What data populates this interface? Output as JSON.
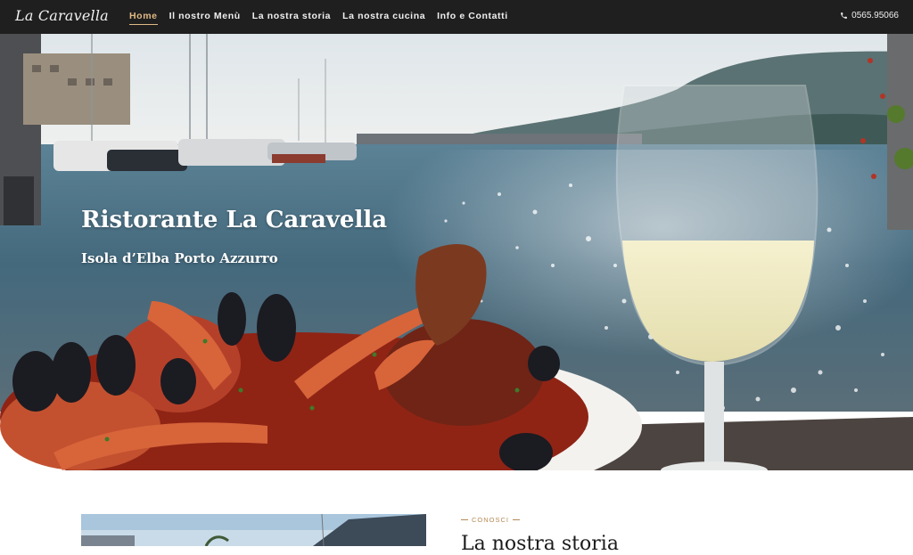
{
  "nav": {
    "logo": "La Caravella",
    "items": [
      {
        "label": "Home",
        "active": true
      },
      {
        "label": "Il nostro Menù",
        "active": false
      },
      {
        "label": "La nostra storia",
        "active": false
      },
      {
        "label": "La nostra cucina",
        "active": false
      },
      {
        "label": "Info e Contatti",
        "active": false
      }
    ],
    "phone": "0565.95066",
    "phone_icon": "phone-icon",
    "accent_color": "#e0b985",
    "bar_color": "#1f1f1f"
  },
  "hero": {
    "title": "Ristorante La Caravella",
    "subtitle": "Isola d’Elba Porto Azzurro"
  },
  "story": {
    "eyebrow": "CONOSCI",
    "heading": "La nostra storia",
    "accent_color": "#b68a55"
  }
}
